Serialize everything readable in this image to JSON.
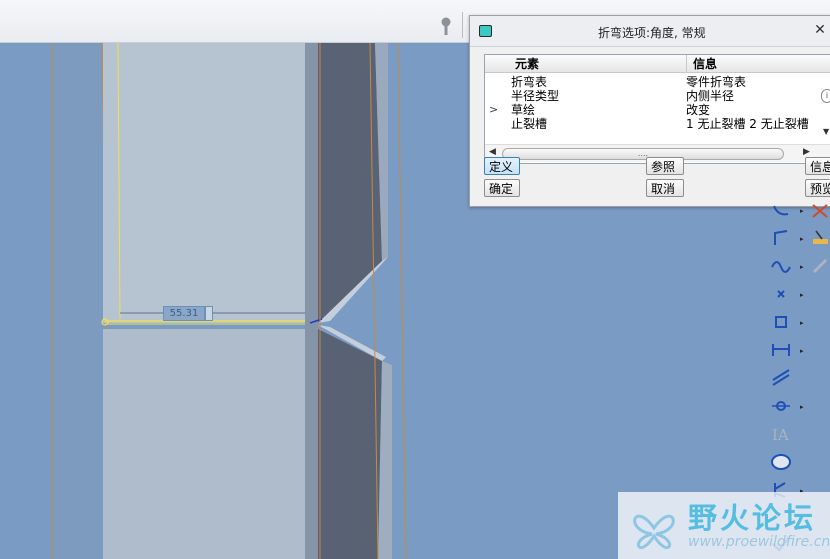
{
  "dialog": {
    "title": "折弯选项:角度, 常规",
    "close_symbol": "✕",
    "columns": {
      "element": "元素",
      "info": "信息"
    },
    "rows": [
      {
        "element": "折弯表",
        "info": "零件折弯表",
        "expander": ""
      },
      {
        "element": "半径类型",
        "info": "内侧半径",
        "expander": ""
      },
      {
        "element": "草绘",
        "info": "改变",
        "expander": ">"
      },
      {
        "element": "止裂槽",
        "info": "1 无止裂槽 2 无止裂槽",
        "expander": ""
      }
    ],
    "scroll_left": "◀",
    "scroll_right": "▶",
    "scroll_grip": "....",
    "info_symbol": "i",
    "scroll_down": "▼",
    "buttons": {
      "define": "定义",
      "refs": "参照",
      "info": "信息",
      "ok": "确定",
      "cancel": "取消",
      "preview": "预览"
    }
  },
  "dimension": {
    "value": "55.31"
  },
  "right_toolbar": {
    "icons": [
      "curve-arrow-icon",
      "line-icon",
      "spline-icon",
      "point-icon",
      "offset-icon",
      "dimension-icon",
      "constraint-icon",
      "circle-point-icon",
      "text-icon",
      "palette-icon",
      "mirror-icon",
      "check-icon"
    ],
    "arrow": "▸"
  },
  "watermark": {
    "title": "野火论坛",
    "url": "www.proewildfire.cn"
  },
  "colors": {
    "viewport_bg": "#7a9bc4",
    "dialog_accent": "#3cc9c5",
    "edge_orange": "#d4832a",
    "sketch_yellow": "#f2e14a",
    "selection_blue": "#3c7fb1"
  }
}
